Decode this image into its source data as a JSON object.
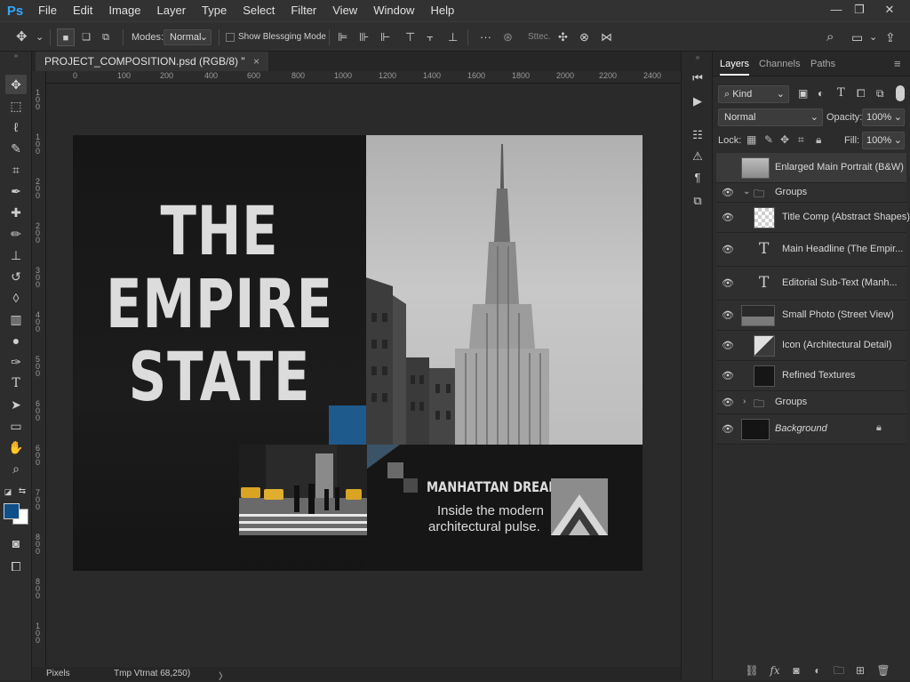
{
  "app": {
    "logo": "Ps"
  },
  "menu": [
    "File",
    "Edit",
    "Image",
    "Layer",
    "Type",
    "Select",
    "Filter",
    "View",
    "Window",
    "Help"
  ],
  "options": {
    "modes_label": "Modes:",
    "mode_value": "Normal",
    "blending_label": "Show Blessging Mode",
    "extra_label": "Sttec."
  },
  "document": {
    "tab_title": "PROJECT_COMPOSITION.psd (RGB/8) \"",
    "close": "×"
  },
  "ruler": {
    "h": [
      "0",
      "100",
      "200",
      "400",
      "600",
      "800",
      "1000",
      "1200",
      "1400",
      "1600",
      "1800",
      "2000",
      "2200",
      "2400"
    ],
    "v": [
      "1\n0\n0",
      "1\n0\n0",
      "2\n0\n0",
      "2\n0\n0",
      "3\n0\n0",
      "4\n0\n0",
      "5\n0\n0",
      "6\n0\n0",
      "6\n0\n0",
      "7\n0\n0",
      "8\n0\n0",
      "8\n0\n0",
      "1\n0\n0"
    ]
  },
  "canvas": {
    "headline": [
      "THE",
      "EMPIRE",
      "STATE"
    ],
    "caption_title": "MANHATTAN DREAMS",
    "caption_body": [
      "Inside the modern",
      "architectural pulse."
    ]
  },
  "status": {
    "unit": "Pixels",
    "info": "Tmp Vtrnat 68,250)",
    "arrow": "〉"
  },
  "colors": {
    "accent": "#1e5a8c",
    "foreground": "#0f4f8a",
    "background": "#ffffff"
  },
  "layers_panel": {
    "tabs": [
      "Layers",
      "Channels",
      "Paths"
    ],
    "filter_kind": "Kind",
    "blend_mode": "Normal",
    "opacity_label": "Opacity:",
    "opacity_value": "100%",
    "lock_label": "Lock:",
    "fill_label": "Fill:",
    "fill_value": "100%",
    "layers": [
      {
        "name": "Enlarged Main Portrait (B&W)",
        "visible": false,
        "kind": "image",
        "thumb": "bw-tower"
      },
      {
        "name": "Groups",
        "visible": true,
        "kind": "group-open"
      },
      {
        "name": "Title Comp (Abstract Shapes)",
        "visible": true,
        "kind": "image",
        "thumb": "checker"
      },
      {
        "name": "Main Headline (The Empir...",
        "visible": true,
        "kind": "text"
      },
      {
        "name": "Editorial Sub-Text (Manh...",
        "visible": true,
        "kind": "text"
      },
      {
        "name": "Small Photo (Street View)",
        "visible": true,
        "kind": "image",
        "thumb": "street"
      },
      {
        "name": "Icon (Architectural Detail)",
        "visible": true,
        "kind": "image",
        "thumb": "detail"
      },
      {
        "name": "Refined Textures",
        "visible": true,
        "kind": "image",
        "thumb": "dark"
      },
      {
        "name": "Groups",
        "visible": true,
        "kind": "group-closed"
      },
      {
        "name": "Background",
        "visible": true,
        "kind": "background",
        "thumb": "dark"
      }
    ]
  }
}
